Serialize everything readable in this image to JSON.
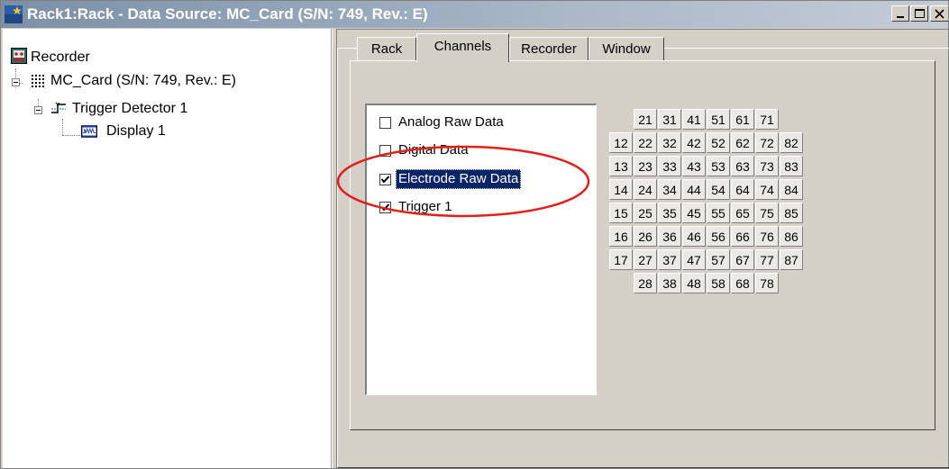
{
  "window": {
    "title": "Rack1:Rack - Data Source: MC_Card (S/N: 749, Rev.: E)",
    "icon": "app-star-icon",
    "controls": [
      "minimize-icon",
      "maximize-icon",
      "close-icon"
    ]
  },
  "tree": {
    "root": {
      "label": "Recorder",
      "icon": "recorder-icon"
    },
    "card": {
      "label": "MC_Card (S/N: 749, Rev.: E)",
      "icon": "card-grid-icon"
    },
    "trigger": {
      "label": "Trigger Detector 1",
      "icon": "trigger-icon"
    },
    "display": {
      "label": "Display 1",
      "icon": "display-icon"
    }
  },
  "tabs": [
    {
      "label": "Rack",
      "active": false
    },
    {
      "label": "Channels",
      "active": true
    },
    {
      "label": "Recorder",
      "active": false
    },
    {
      "label": "Window",
      "active": false
    }
  ],
  "streams": [
    {
      "label": "Analog Raw Data",
      "checked": false,
      "selected": false
    },
    {
      "label": "Digital Data",
      "checked": false,
      "selected": false
    },
    {
      "label": "Electrode Raw Data",
      "checked": true,
      "selected": true
    },
    {
      "label": "Trigger 1",
      "checked": true,
      "selected": false
    }
  ],
  "channel_grid": [
    [
      "",
      "21",
      "31",
      "41",
      "51",
      "61",
      "71",
      ""
    ],
    [
      "12",
      "22",
      "32",
      "42",
      "52",
      "62",
      "72",
      "82"
    ],
    [
      "13",
      "23",
      "33",
      "43",
      "53",
      "63",
      "73",
      "83"
    ],
    [
      "14",
      "24",
      "34",
      "44",
      "54",
      "64",
      "74",
      "84"
    ],
    [
      "15",
      "25",
      "35",
      "45",
      "55",
      "65",
      "75",
      "85"
    ],
    [
      "16",
      "26",
      "36",
      "46",
      "56",
      "66",
      "76",
      "86"
    ],
    [
      "17",
      "27",
      "37",
      "47",
      "57",
      "67",
      "77",
      "87"
    ],
    [
      "",
      "28",
      "38",
      "48",
      "58",
      "68",
      "78",
      ""
    ]
  ],
  "colors": {
    "highlight_ellipse": "#e0201c",
    "selection": "#0a246a"
  }
}
